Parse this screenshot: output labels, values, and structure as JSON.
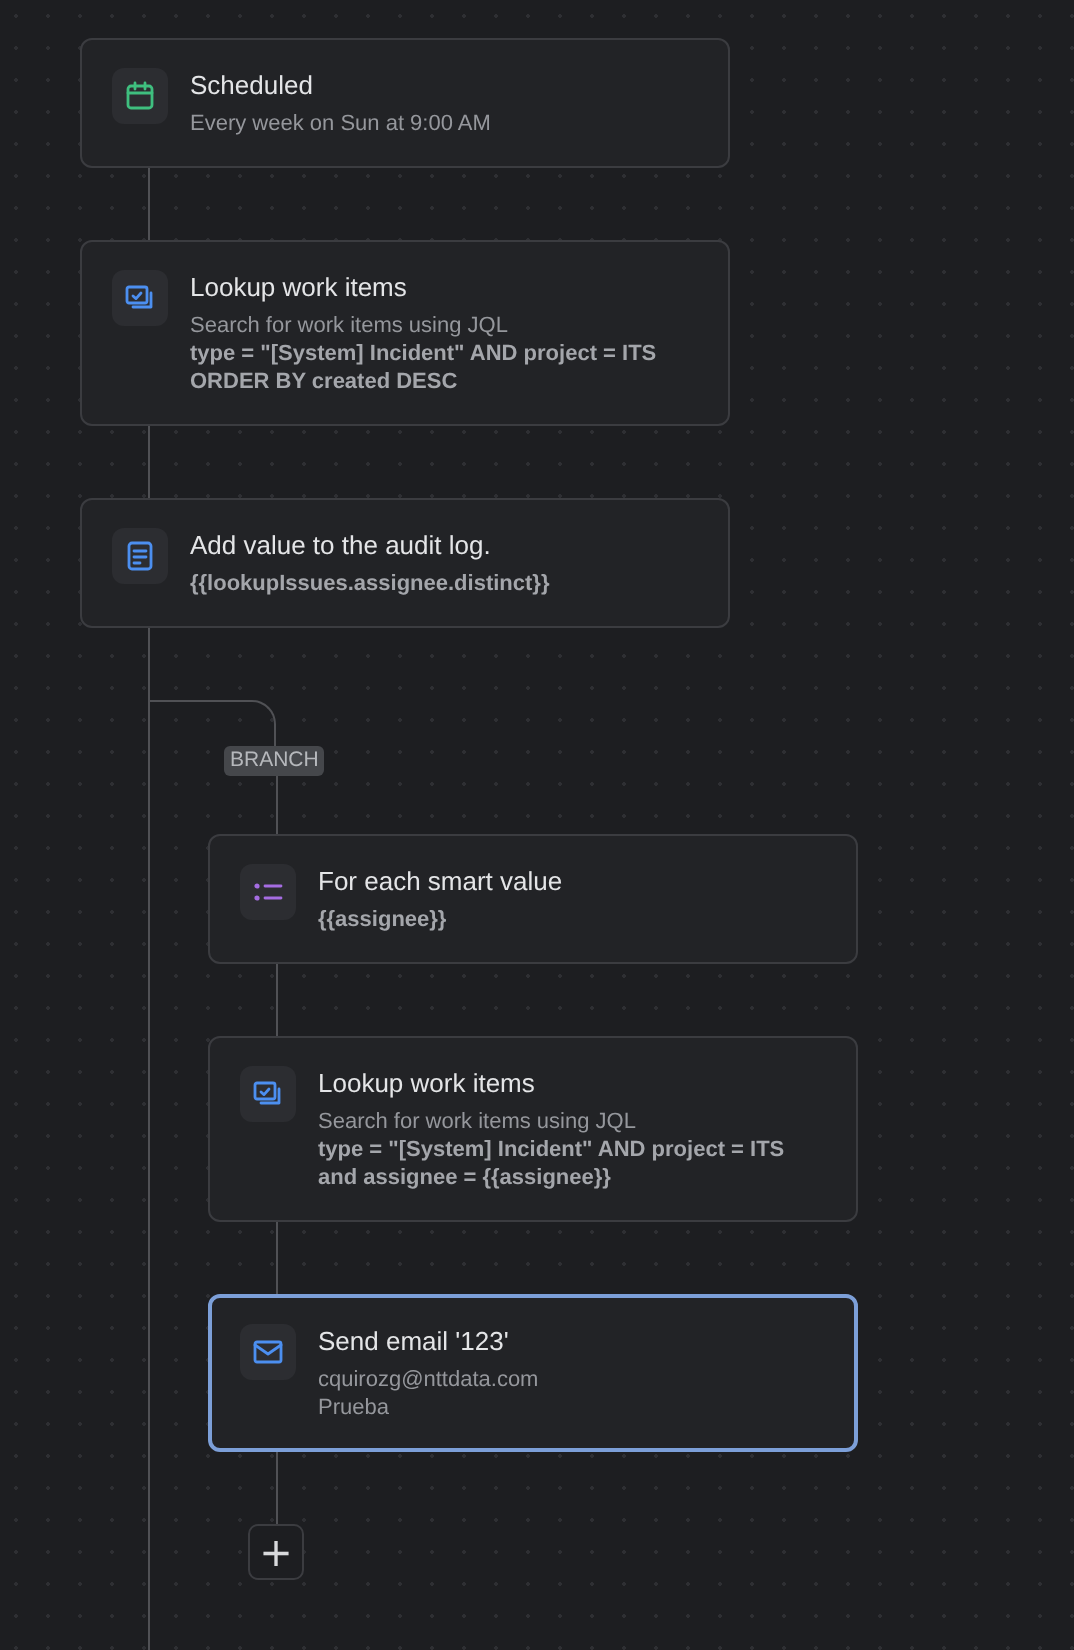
{
  "steps": [
    {
      "kind": "schedule",
      "title": "Scheduled",
      "selected": false,
      "lines": [
        {
          "text": "Every week on Sun at 9:00 AM",
          "bold": false
        }
      ]
    },
    {
      "kind": "lookup",
      "title": "Lookup work items",
      "selected": false,
      "lines": [
        {
          "text": "Search for work items using JQL",
          "bold": false
        },
        {
          "text": "type = \"[System] Incident\" AND project = ITS",
          "bold": true
        },
        {
          "text": "ORDER BY created DESC",
          "bold": true
        }
      ]
    },
    {
      "kind": "log",
      "title": "Add value to the audit log.",
      "selected": false,
      "lines": [
        {
          "text": "{{lookupIssues.assignee.distinct}}",
          "bold": true
        }
      ]
    }
  ],
  "branch": {
    "label": "BRANCH",
    "steps": [
      {
        "kind": "foreach",
        "title": "For each smart value",
        "selected": false,
        "lines": [
          {
            "text": "{{assignee}}",
            "bold": true
          }
        ]
      },
      {
        "kind": "lookup",
        "title": "Lookup work items",
        "selected": false,
        "lines": [
          {
            "text": "Search for work items using JQL",
            "bold": false
          },
          {
            "text": "type = \"[System] Incident\" AND project = ITS",
            "bold": true
          },
          {
            "text": "and assignee = {{assignee}}",
            "bold": true
          }
        ]
      },
      {
        "kind": "email",
        "title": "Send email '123'",
        "selected": true,
        "lines": [
          {
            "text": "cquirozg@nttdata.com",
            "bold": false
          },
          {
            "text": "Prueba",
            "bold": false
          }
        ]
      }
    ],
    "add_button": "+"
  }
}
